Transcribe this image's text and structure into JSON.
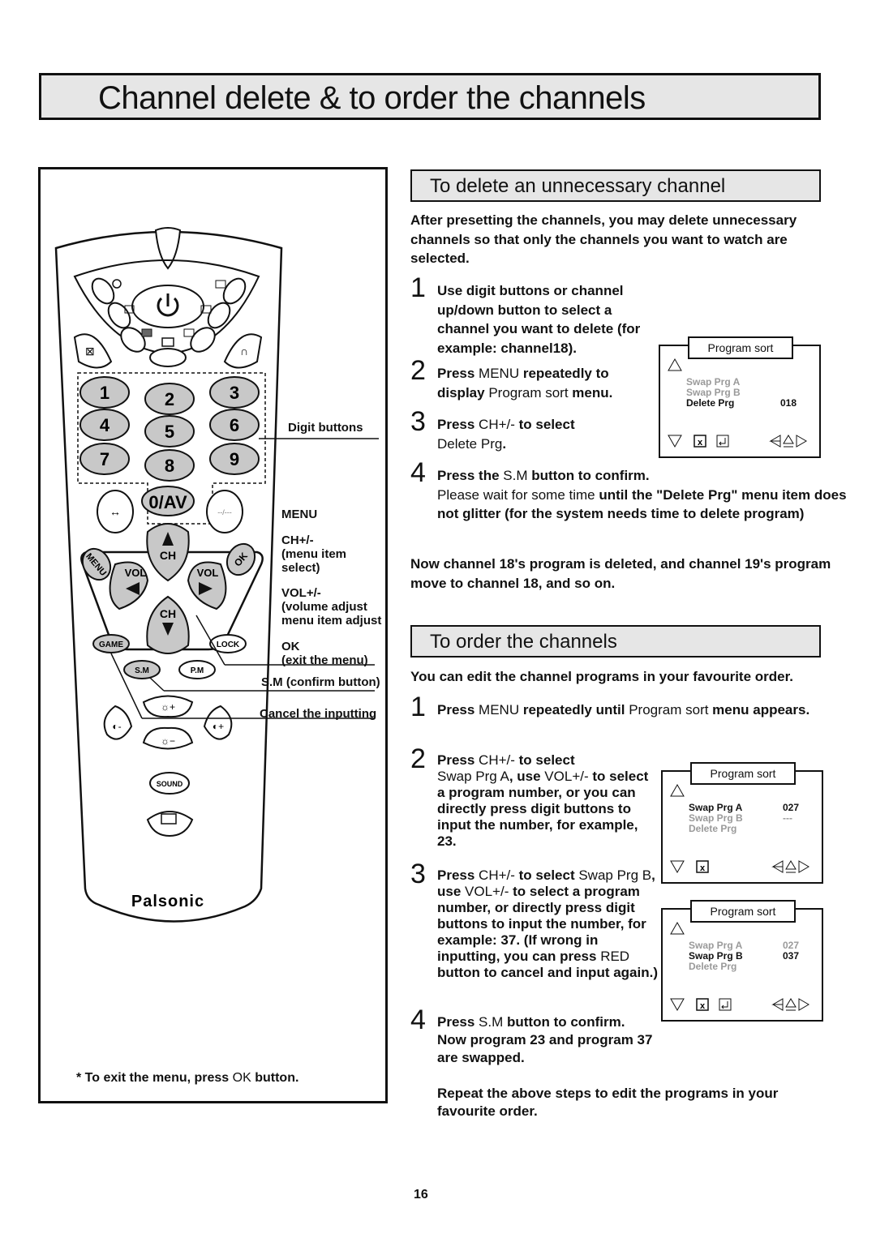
{
  "page_title": "Channel delete & to order the channels",
  "page_number": "16",
  "remote": {
    "brand": "Palsonic",
    "digit_keys": [
      "1",
      "2",
      "3",
      "4",
      "5",
      "6",
      "7",
      "8",
      "9"
    ],
    "zero_key": "0/AV",
    "swap_key": "--/---",
    "ch_label": "CH",
    "vol_label": "VOL",
    "menu_key": "MENU",
    "ok_key": "OK",
    "game_key": "GAME",
    "lock_key": "LOCK",
    "sm_key": "S.M",
    "pm_key": "P.M",
    "sound_key": "SOUND",
    "callouts": {
      "digit_buttons": "Digit buttons",
      "menu": "MENU",
      "ch": "CH+/-",
      "ch_desc_1": "(menu item",
      "ch_desc_2": "select)",
      "vol": "VOL+/-",
      "vol_desc_1": "(volume adjust",
      "vol_desc_2": "menu item adjust",
      "ok": "OK",
      "ok_desc": "(exit the menu)",
      "sm": "S.M (confirm button)",
      "cancel": "Cancel the inputting"
    },
    "footnote": {
      "prefix": "* To exit the menu, press ",
      "key": "OK",
      "suffix": " button."
    }
  },
  "delete_section": {
    "heading": "To delete an unnecessary channel",
    "intro": "After presetting the channels, you may delete unnecessary channels so that only the channels you want to watch are selected.",
    "steps": [
      {
        "num": "1",
        "text": "Use digit buttons or channel up/down button to select a channel you want to delete (for example: channel18)."
      },
      {
        "num": "2",
        "a": "Press ",
        "b": "MENU",
        "c": " repeatedly to display ",
        "d": "Program sort",
        "e": " menu."
      },
      {
        "num": "3",
        "a": "Press ",
        "b": "CH+/-",
        "c": " to select",
        "d": "Delete Prg",
        "e": "."
      },
      {
        "num": "4",
        "a": "Press the ",
        "b": "S.M",
        "c": " button to confirm.",
        "d": "Please wait for some time ",
        "e": "until the \"Delete Prg\" menu item does not glitter (for the system needs time to delete program)"
      }
    ],
    "result": "Now channel 18's program is deleted, and channel 19's program move to channel 18, and so on.",
    "menu": {
      "title": "Program sort",
      "rows": [
        {
          "label": "Swap Prg A",
          "value": "",
          "active": false
        },
        {
          "label": "Swap Prg B",
          "value": "",
          "active": false
        },
        {
          "label": "Delete Prg",
          "value": "018",
          "active": true
        }
      ]
    }
  },
  "order_section": {
    "heading": "To order the channels",
    "intro": "You can edit the channel programs in your favourite order.",
    "steps": [
      {
        "num": "1",
        "a": "Press ",
        "b": "MENU",
        "c": " repeatedly until ",
        "d": "Program sort",
        "e": " menu appears."
      },
      {
        "num": "2",
        "a": "Press ",
        "b": "CH+/-",
        "c": " to select",
        "d": "Swap Prg A",
        "e": ", use ",
        "f": "VOL+/-",
        "g": " to select a program number, or you can directly press digit buttons to input the number, for example, 23."
      },
      {
        "num": "3",
        "a": "Press ",
        "b": "CH+/-",
        "c": " to select ",
        "d": "Swap Prg B",
        "e": ", use ",
        "f": "VOL+/-",
        "g": " to select a program number, or directly press digit buttons to input the number, for example: 37. (If wrong in inputting, you can press ",
        "h": "RED",
        "i": " button to cancel and input again.)"
      },
      {
        "num": "4",
        "a": "Press ",
        "b": "S.M",
        "c": " button to confirm. Now program 23 and program 37 are swapped."
      }
    ],
    "closing": "Repeat the above steps to edit the programs in your favourite order.",
    "menu_a": {
      "title": "Program sort",
      "rows": [
        {
          "label": "Swap Prg A",
          "value": "027",
          "active": true
        },
        {
          "label": "Swap Prg B",
          "value": "---",
          "active": false
        },
        {
          "label": "Delete Prg",
          "value": "",
          "active": false
        }
      ]
    },
    "menu_b": {
      "title": "Program sort",
      "rows": [
        {
          "label": "Swap Prg A",
          "value": "027",
          "active": false
        },
        {
          "label": "Swap Prg B",
          "value": "037",
          "active": true
        },
        {
          "label": "Delete Prg",
          "value": "",
          "active": false
        }
      ]
    }
  }
}
